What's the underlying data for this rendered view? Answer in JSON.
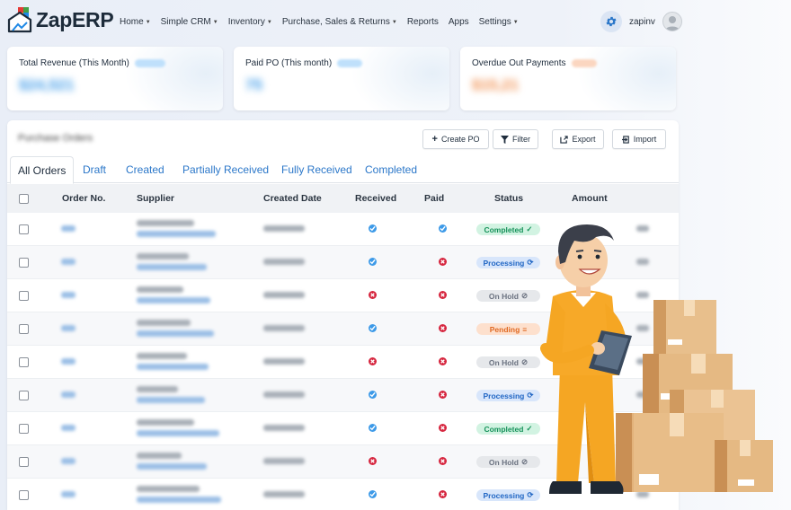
{
  "brand": {
    "name": "ZapERP"
  },
  "nav": {
    "items": [
      {
        "label": "Home",
        "dropdown": true
      },
      {
        "label": "Simple CRM",
        "dropdown": true
      },
      {
        "label": "Inventory",
        "dropdown": true
      },
      {
        "label": "Purchase, Sales & Returns",
        "dropdown": true
      },
      {
        "label": "Reports",
        "dropdown": false
      },
      {
        "label": "Apps",
        "dropdown": false
      },
      {
        "label": "Settings",
        "dropdown": true
      }
    ],
    "user_name": "zapinv"
  },
  "cards": [
    {
      "title": "Total Revenue (This Month)",
      "value": "$24,521",
      "accent": "#3d9ae8"
    },
    {
      "title": "Paid PO (This month)",
      "value": "75",
      "accent": "#3d9ae8"
    },
    {
      "title": "Overdue Out Payments",
      "value": "$15,21",
      "accent": "#f08c4a"
    }
  ],
  "panel": {
    "title": "Purchase Orders",
    "buttons": {
      "create": "Create PO",
      "filter": "Filter",
      "export": "Export",
      "import": "Import"
    },
    "tabs": [
      "All Orders",
      "Draft",
      "Created",
      "Partially Received",
      "Fully Received",
      "Completed"
    ],
    "columns": [
      "Order No.",
      "Supplier",
      "Created Date",
      "Received",
      "Paid",
      "Status",
      "Amount"
    ]
  },
  "rows": [
    {
      "received": true,
      "paid": true,
      "status": "Completed",
      "status_icon": "check-icon"
    },
    {
      "received": true,
      "paid": false,
      "status": "Processing",
      "status_icon": "refresh-icon"
    },
    {
      "received": false,
      "paid": false,
      "status": "On Hold",
      "status_icon": "ban-icon"
    },
    {
      "received": true,
      "paid": false,
      "status": "Pending",
      "status_icon": "list-icon"
    },
    {
      "received": false,
      "paid": false,
      "status": "On Hold",
      "status_icon": "ban-icon"
    },
    {
      "received": true,
      "paid": false,
      "status": "Processing",
      "status_icon": "refresh-icon"
    },
    {
      "received": true,
      "paid": false,
      "status": "Completed",
      "status_icon": "check-icon"
    },
    {
      "received": false,
      "paid": false,
      "status": "On Hold",
      "status_icon": "ban-icon"
    },
    {
      "received": true,
      "paid": false,
      "status": "Processing",
      "status_icon": "refresh-icon"
    }
  ],
  "colors": {
    "link": "#2b77c9",
    "completed": "#16925a",
    "processing": "#2066c4",
    "on_hold": "#6b7280",
    "pending": "#e06a24",
    "received_ok": "#3d9ae8",
    "unpaid": "#d6263f"
  }
}
